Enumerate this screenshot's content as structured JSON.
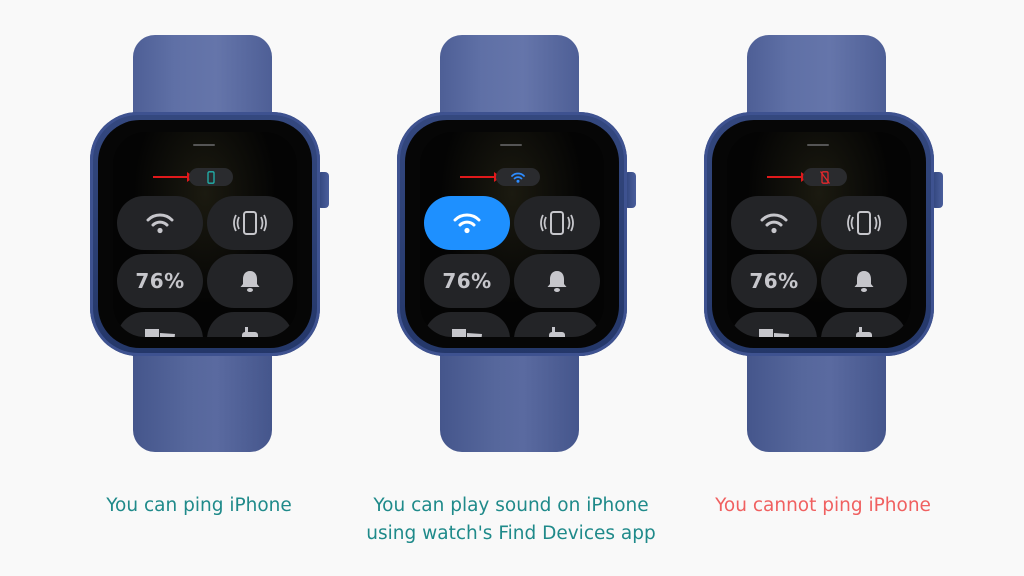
{
  "colors": {
    "background": "#f9f9f9",
    "band": "#5f70a6",
    "case": "#2e4278",
    "caption_ok": "#1f8a8a",
    "caption_bad": "#f06060",
    "arrow": "#e0191b",
    "wifi_active": "#1e90ff"
  },
  "watches": [
    {
      "status_icon": "iphone-connected-icon",
      "status_color": "#22b3ad",
      "tiles": {
        "wifi_active": false,
        "battery": "76%"
      },
      "caption": "You can ping iPhone",
      "caption_line2": "",
      "caption_tone": "ok"
    },
    {
      "status_icon": "wifi-connected-icon",
      "status_color": "#2d8cff",
      "tiles": {
        "wifi_active": true,
        "battery": "76%"
      },
      "caption": "You can play sound on iPhone",
      "caption_line2": "using watch's Find Devices app",
      "caption_tone": "ok"
    },
    {
      "status_icon": "iphone-disconnected-icon",
      "status_color": "#e5282c",
      "tiles": {
        "wifi_active": false,
        "battery": "76%"
      },
      "caption": "You cannot ping iPhone",
      "caption_line2": "",
      "caption_tone": "bad"
    }
  ]
}
